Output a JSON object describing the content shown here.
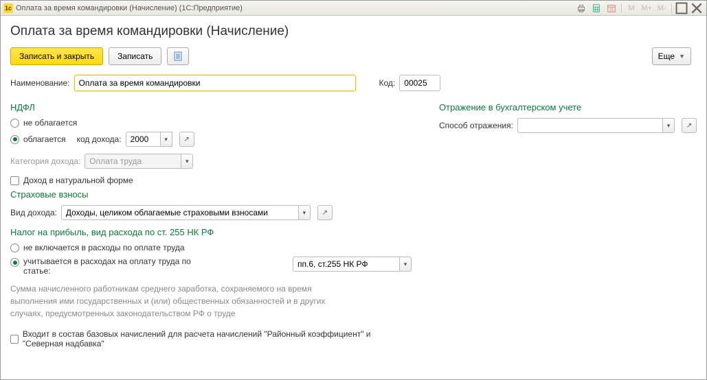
{
  "window": {
    "title": "Оплата за время командировки (Начисление)  (1С:Предприятие)"
  },
  "page_title": "Оплата за время командировки (Начисление)",
  "toolbar": {
    "save_close": "Записать и закрыть",
    "save": "Записать",
    "more": "Еще"
  },
  "fields": {
    "name_label": "Наименование:",
    "name_value": "Оплата за время командировки",
    "code_label": "Код:",
    "code_value": "00025"
  },
  "ndfl": {
    "heading": "НДФЛ",
    "not_taxed": "не облагается",
    "taxed": "облагается",
    "income_code_label": "код дохода:",
    "income_code_value": "2000",
    "category_label": "Категория дохода:",
    "category_value": "Оплата труда",
    "natural_form": "Доход в натуральной форме"
  },
  "accounting": {
    "heading": "Отражение в бухгалтерском учете",
    "method_label": "Способ отражения:",
    "method_value": ""
  },
  "insurance": {
    "heading": "Страховые взносы",
    "type_label": "Вид дохода:",
    "type_value": "Доходы, целиком облагаемые страховыми взносами"
  },
  "profit_tax": {
    "heading": "Налог на прибыль, вид расхода по ст. 255 НК РФ",
    "not_included": "не включается в расходы по оплате труда",
    "included": "учитывается в расходах на оплату труда по статье:",
    "article_value": "пп.6, ст.255 НК РФ",
    "description": "Сумма начисленного работникам среднего заработка, сохраняемого на время выполнения ими государственных и (или) общественных обязанностей и в других случаях, предусмотренных законодательством РФ о труде"
  },
  "base_accrual": "Входит в состав базовых начислений для расчета начислений \"Районный коэффициент\" и \"Северная надбавка\""
}
